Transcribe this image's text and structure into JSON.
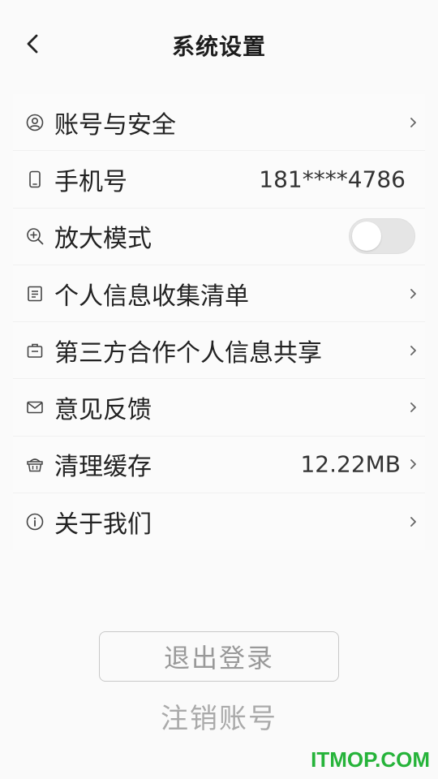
{
  "header": {
    "title": "系统设置",
    "back_icon": "chevron-left-icon"
  },
  "settings": {
    "items": [
      {
        "id": "account-security",
        "icon": "user-circle-icon",
        "label": "账号与安全",
        "value": "",
        "control": "chevron"
      },
      {
        "id": "phone",
        "icon": "phone-icon",
        "label": "手机号",
        "value": "181****4786",
        "control": "none"
      },
      {
        "id": "zoom-mode",
        "icon": "zoom-in-icon",
        "label": "放大模式",
        "value": "",
        "control": "toggle",
        "toggle_on": false
      },
      {
        "id": "personal-info-list",
        "icon": "document-list-icon",
        "label": "个人信息收集清单",
        "value": "",
        "control": "chevron"
      },
      {
        "id": "third-party-sharing",
        "icon": "briefcase-icon",
        "label": "第三方合作个人信息共享",
        "value": "",
        "control": "chevron"
      },
      {
        "id": "feedback",
        "icon": "mail-icon",
        "label": "意见反馈",
        "value": "",
        "control": "chevron"
      },
      {
        "id": "clear-cache",
        "icon": "basket-icon",
        "label": "清理缓存",
        "value": "12.22MB",
        "control": "chevron"
      },
      {
        "id": "about-us",
        "icon": "info-icon",
        "label": "关于我们",
        "value": "",
        "control": "chevron"
      }
    ]
  },
  "actions": {
    "logout_label": "退出登录",
    "cancel_account_label": "注销账号"
  },
  "watermark": {
    "text": "ITMOP.COM",
    "color": "#26b33a"
  },
  "colors": {
    "background": "#fafafa",
    "text_primary": "#222222",
    "text_muted": "#999999",
    "toggle_off": "#e5e5e5"
  }
}
